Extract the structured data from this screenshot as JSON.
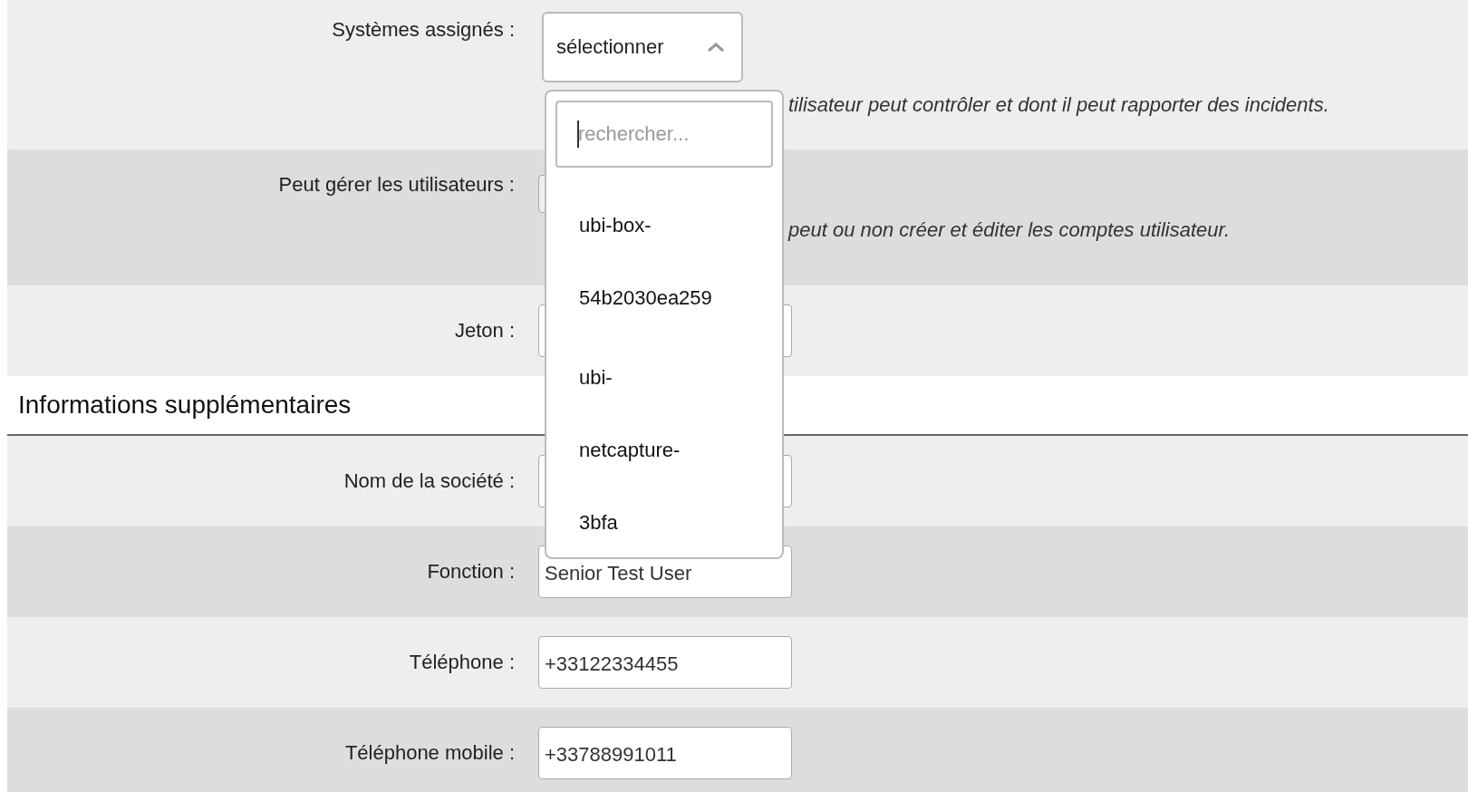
{
  "access_rows": [
    {
      "kind": "multiselect",
      "label": "Systèmes assignés :",
      "button": "sélectionner",
      "expanded": true,
      "description": "tilisateur peut contrôler et dont il peut rapporter des incidents."
    },
    {
      "kind": "select",
      "label": "Peut gérer les utilisateurs :",
      "description": "peut ou non créer et éditer les comptes utilisateur."
    },
    {
      "kind": "input",
      "label": "Jeton :"
    }
  ],
  "dropdown": {
    "placeholder": "rechercher...",
    "options": [
      {
        "lines": [
          "ubi-box-",
          "54b2030ea259"
        ]
      },
      {
        "lines": [
          "ubi-",
          "netcapture-",
          "3bfa"
        ]
      }
    ]
  },
  "section": {
    "title": "Informations supplémentaires"
  },
  "info_rows": [
    {
      "label": "Nom de la société :",
      "value": ""
    },
    {
      "label": "Fonction :",
      "value": "Senior Test User"
    },
    {
      "label": "Téléphone :",
      "value": "+33122334455"
    },
    {
      "label": "Téléphone mobile :",
      "value": "+33788991011"
    }
  ]
}
